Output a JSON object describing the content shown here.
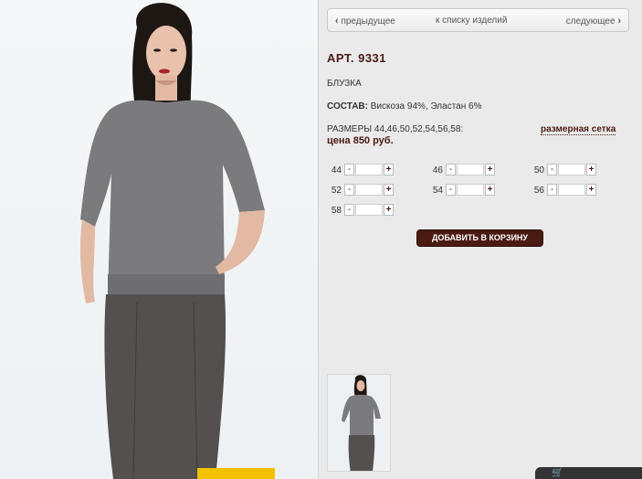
{
  "nav": {
    "prev_label": "предыдущее",
    "list_label": "к списку изделий",
    "next_label": "следующее"
  },
  "product": {
    "article": "АРТ. 9331",
    "type": "БЛУЗКА",
    "composition_label": "СОСТАВ:",
    "composition_value": " Вискоза 94%, Эластан 6%",
    "sizes_text": "РАЗМЕРЫ 44,46,50,52,54,56,58:",
    "size_chart_label": "размерная сетка",
    "price": "цена 850 руб."
  },
  "sizes": [
    {
      "label": "44"
    },
    {
      "label": "46"
    },
    {
      "label": "50"
    },
    {
      "label": "52"
    },
    {
      "label": "54"
    },
    {
      "label": "56"
    },
    {
      "label": "58"
    }
  ],
  "stepper": {
    "minus": "-",
    "plus": "+"
  },
  "add_to_cart_label": "ДОБАВИТЬ В КОРЗИНУ",
  "colors": {
    "accent": "#4a1b12",
    "background": "#eaeaea"
  },
  "icons": {
    "prev": "chevron-left-icon",
    "next": "chevron-right-icon",
    "cart": "cart-icon"
  }
}
